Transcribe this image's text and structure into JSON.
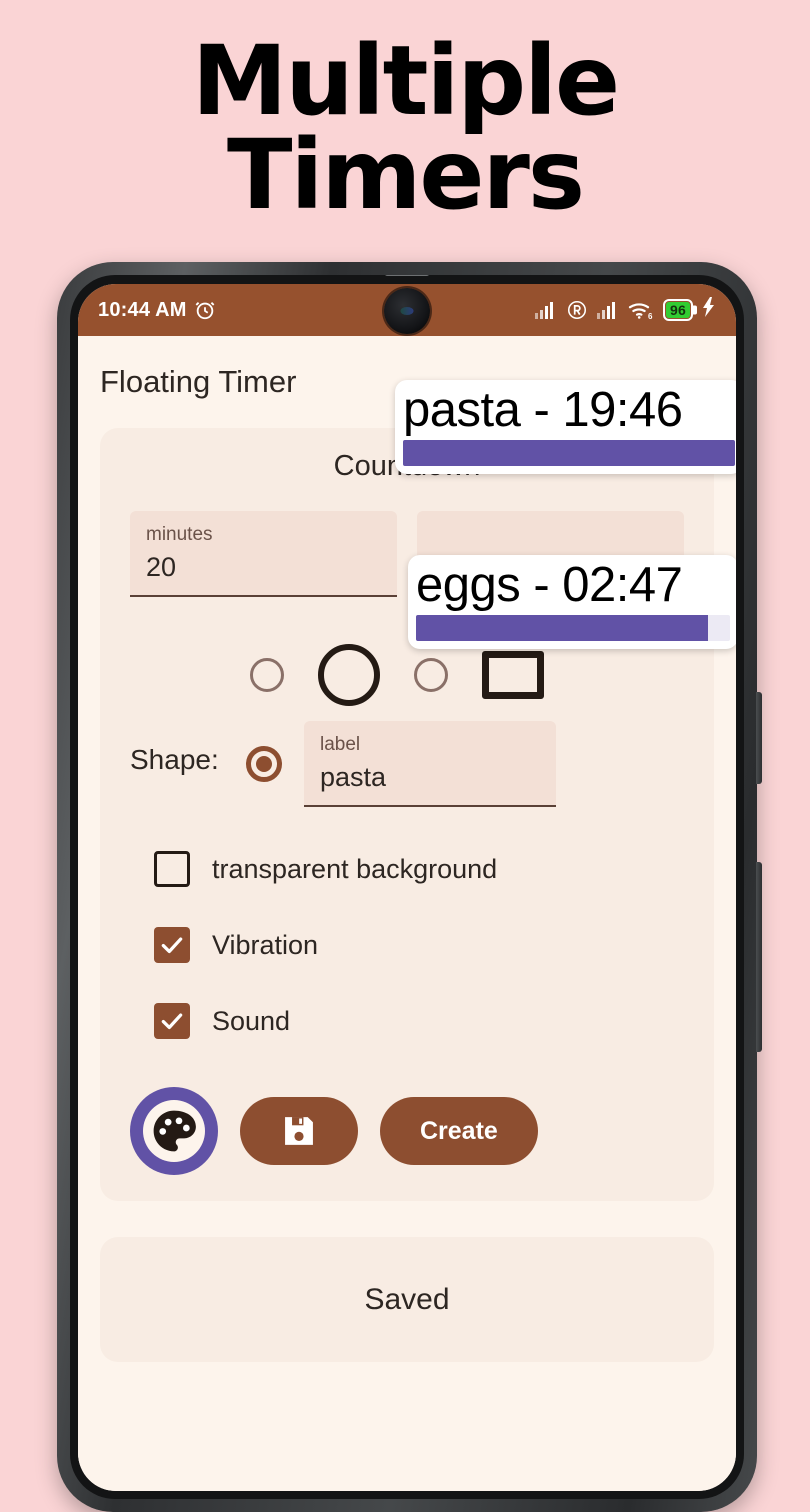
{
  "promo": {
    "line1": "Multiple",
    "line2": "Timers"
  },
  "colors": {
    "page_background": "#fad4d5",
    "status_bar": "#96512e",
    "app_background": "#fdf4ec",
    "card": "#f8ece3",
    "field": "#f3e0d6",
    "accent_brown": "#8d4e30",
    "accent_purple": "#6152a6",
    "battery_green": "#32cd32"
  },
  "status_bar": {
    "time": "10:44 AM",
    "alarm_icon": "alarm-clock-icon",
    "signal_icon": "cellular-signal-icon",
    "roaming_icon": "roaming-r-icon",
    "signal_icon_2": "cellular-signal-icon",
    "wifi_icon": "wifi-6-icon",
    "wifi_generation": "6",
    "battery_level": "96",
    "charging_icon": "charging-bolt-icon"
  },
  "app": {
    "title": "Floating Timer"
  },
  "countdown": {
    "section_title": "Countdown",
    "fields": [
      {
        "label": "minutes",
        "value": "20"
      },
      {
        "label": "",
        "value": ""
      }
    ],
    "shape": {
      "label": "Shape:",
      "glyphs": [
        "small-circle-shape",
        "large-circle-shape",
        "small-circle-shape",
        "rectangle-shape"
      ],
      "selected_radio": "radio-selected"
    },
    "label_field": {
      "label": "label",
      "value": "pasta"
    },
    "checkboxes": [
      {
        "label": "transparent background",
        "checked": false
      },
      {
        "label": "Vibration",
        "checked": true
      },
      {
        "label": "Sound",
        "checked": true
      }
    ],
    "actions": {
      "palette_button_icon": "color-palette-icon",
      "save_button_icon": "floppy-disk-save-icon",
      "create_label": "Create"
    }
  },
  "saved": {
    "title": "Saved"
  },
  "overlays": [
    {
      "text": "pasta - 19:46",
      "progress_percent": 100
    },
    {
      "text": "eggs - 02:47",
      "progress_percent": 93
    }
  ]
}
